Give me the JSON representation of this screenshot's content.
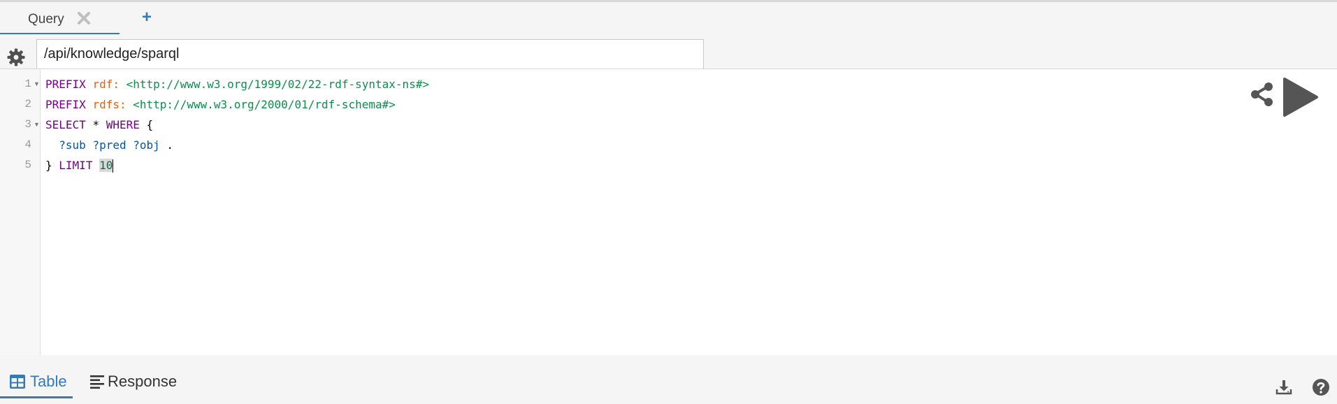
{
  "tabs": [
    {
      "label": "Query",
      "active": true
    }
  ],
  "tab_add_label": "+",
  "endpoint": {
    "value": "/api/knowledge/sparql"
  },
  "editor": {
    "line_numbers": [
      "1",
      "2",
      "3",
      "4",
      "5"
    ],
    "lines": [
      {
        "kw": "PREFIX",
        "prefix": "rdf:",
        "iri": "<http://www.w3.org/1999/02/22-rdf-syntax-ns#>"
      },
      {
        "kw": "PREFIX",
        "prefix": "rdfs:",
        "iri": "<http://www.w3.org/2000/01/rdf-schema#>"
      },
      {
        "kw1": "SELECT",
        "star": "*",
        "kw2": "WHERE",
        "brace": "{"
      },
      {
        "v1": "?sub",
        "v2": "?pred",
        "v3": "?obj",
        "dot": "."
      },
      {
        "brace": "}",
        "kw": "LIMIT",
        "num": "10"
      }
    ]
  },
  "results_tabs": [
    {
      "label": "Table",
      "icon": "table-icon",
      "active": true
    },
    {
      "label": "Response",
      "icon": "align-left-icon",
      "active": false
    }
  ],
  "colors": {
    "accent": "#337ab7",
    "keyword": "#770088",
    "prefix": "#e8620c",
    "iri": "#0a8f4c",
    "variable": "#0055aa"
  }
}
